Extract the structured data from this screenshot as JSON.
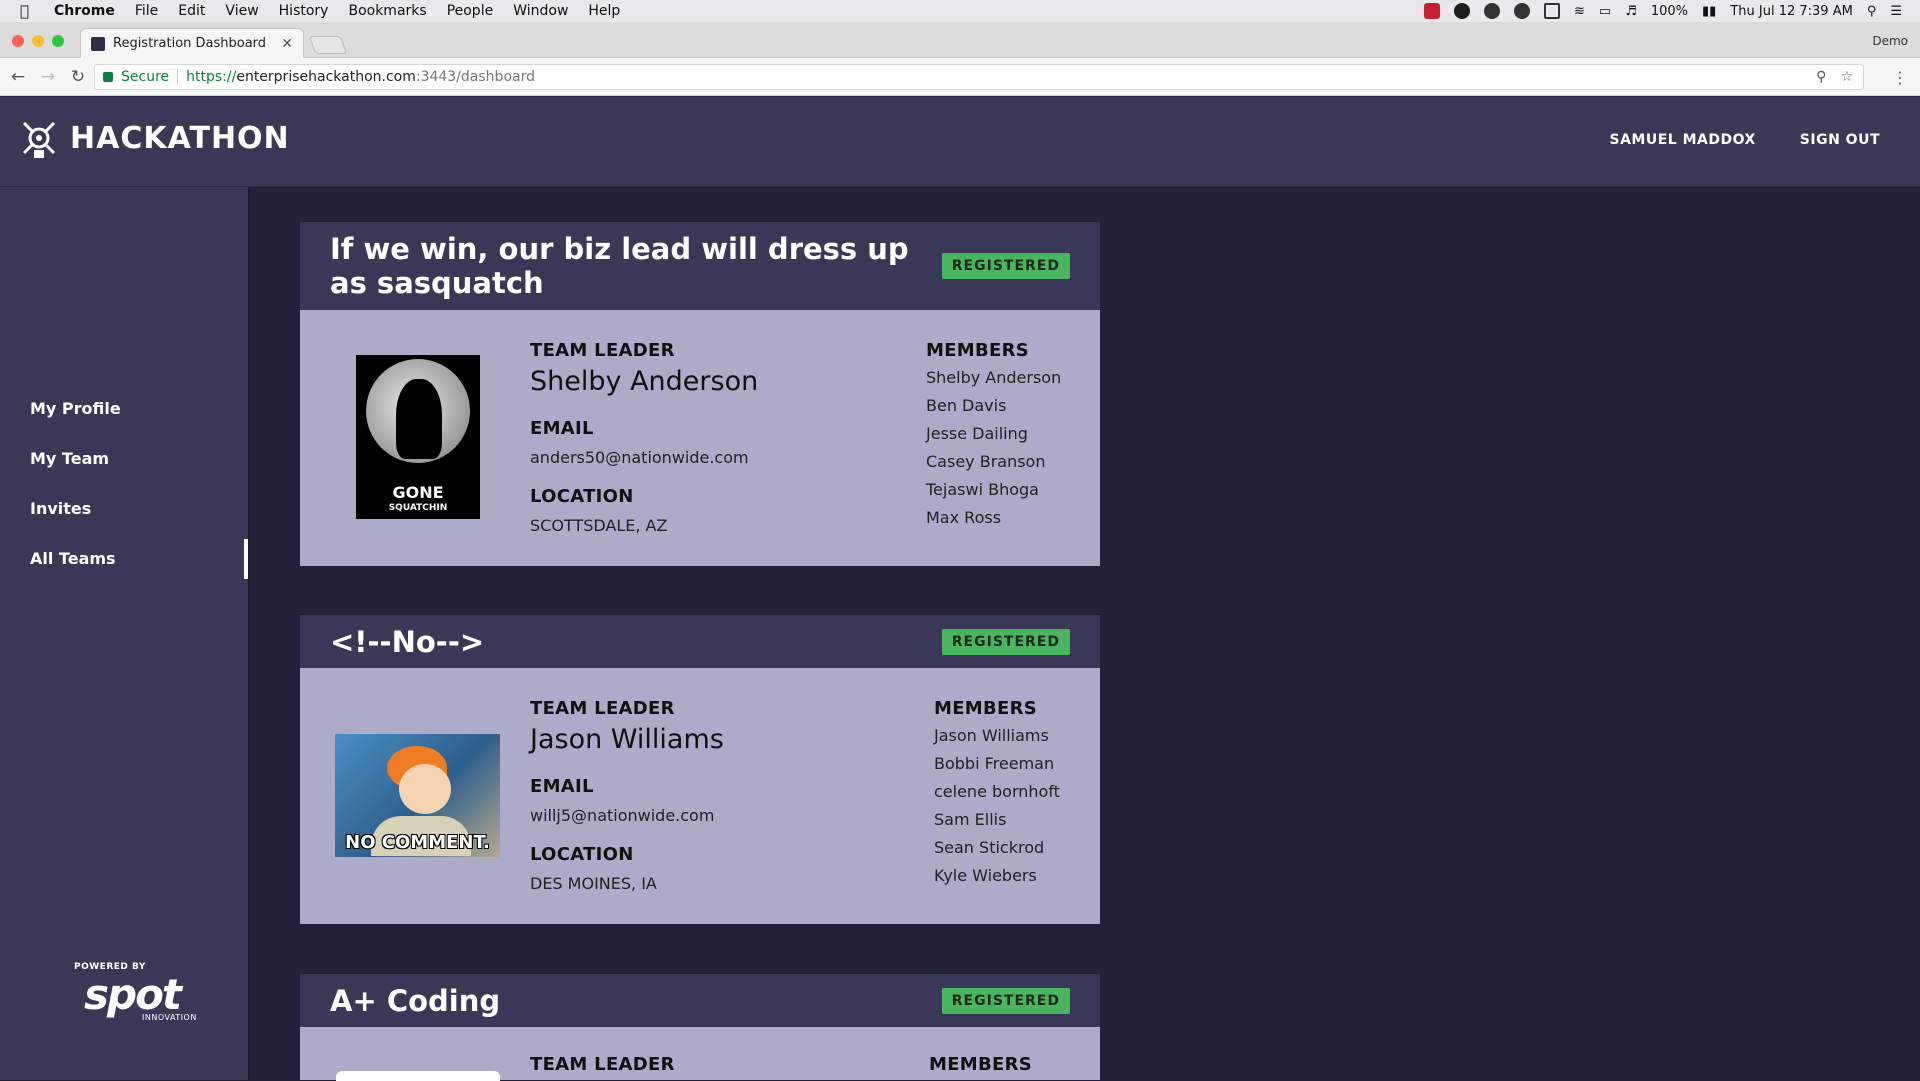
{
  "menubar": {
    "items": [
      "Chrome",
      "File",
      "Edit",
      "View",
      "History",
      "Bookmarks",
      "People",
      "Window",
      "Help"
    ],
    "battery": "100%",
    "datetime": "Thu Jul 12  7:39 AM"
  },
  "browser": {
    "tab_title": "Registration Dashboard",
    "profile_name": "Demo",
    "secure_label": "Secure",
    "url_scheme": "https://",
    "url_host": "enterprisehackathon.com",
    "url_path": ":3443/dashboard"
  },
  "app": {
    "logo_text": "HACKATHON",
    "user_name": "SAMUEL MADDOX",
    "sign_out_label": "SIGN OUT"
  },
  "sidebar": {
    "items": [
      {
        "label": "My Profile"
      },
      {
        "label": "My Team"
      },
      {
        "label": "Invites"
      },
      {
        "label": "All Teams",
        "active": true
      }
    ],
    "powered_by": "POWERED BY",
    "brand": "spot",
    "brand_sub": "INNOVATION"
  },
  "labels": {
    "team_leader": "TEAM LEADER",
    "email": "EMAIL",
    "location": "LOCATION",
    "members": "MEMBERS"
  },
  "teams": [
    {
      "name": "If we win, our biz lead will dress up as sasquatch",
      "status": "REGISTERED",
      "leader": "Shelby Anderson",
      "email": "anders50@nationwide.com",
      "location": "SCOTTSDALE, AZ",
      "avatar_text_1": "GONE",
      "avatar_text_2": "SQUATCHIN",
      "members": [
        "Shelby Anderson",
        "Ben Davis",
        "Jesse Dailing",
        "Casey Branson",
        "Tejaswi Bhoga",
        "Max Ross"
      ]
    },
    {
      "name": "<!--No-->",
      "status": "REGISTERED",
      "leader": "Jason Williams",
      "email": "willj5@nationwide.com",
      "location": "DES MOINES, IA",
      "avatar_text_1": "NO COMMENT.",
      "members": [
        "Jason Williams",
        "Bobbi Freeman",
        "celene bornhoft",
        "Sam Ellis",
        "Sean Stickrod",
        "Kyle Wiebers"
      ]
    },
    {
      "name": "A+ Coding",
      "status": "REGISTERED"
    }
  ]
}
